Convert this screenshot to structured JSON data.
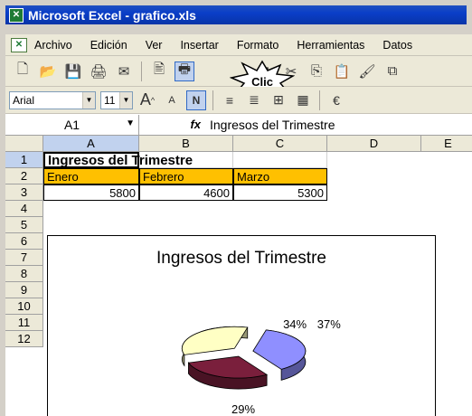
{
  "window": {
    "title": "Microsoft Excel - grafico.xls",
    "app_icon": "excel-icon"
  },
  "menu": {
    "items": [
      "Archivo",
      "Edición",
      "Ver",
      "Insertar",
      "Formato",
      "Herramientas",
      "Datos"
    ]
  },
  "toolbar": {
    "callout": "Clic"
  },
  "format": {
    "font": "Arial",
    "size": "11"
  },
  "formula_bar": {
    "name_box": "A1",
    "fx_label": "fx",
    "content": "Ingresos del Trimestre"
  },
  "sheet": {
    "columns": [
      "A",
      "B",
      "C",
      "D",
      "E"
    ],
    "rows": [
      "1",
      "2",
      "3",
      "4",
      "5",
      "6",
      "7",
      "8",
      "9",
      "10",
      "11",
      "12"
    ],
    "title_cell": "Ingresos del Trimestre",
    "months": [
      "Enero",
      "Febrero",
      "Marzo"
    ],
    "values": [
      "5800",
      "4600",
      "5300"
    ]
  },
  "chart_data": {
    "type": "pie",
    "title": "Ingresos del Trimestre",
    "categories": [
      "Enero",
      "Febrero",
      "Marzo"
    ],
    "values": [
      5800,
      4600,
      5300
    ],
    "slice_labels": [
      "37%",
      "29%",
      "34%"
    ],
    "colors": [
      "#8f8fff",
      "#7a1f3c",
      "#ffffc4"
    ]
  }
}
